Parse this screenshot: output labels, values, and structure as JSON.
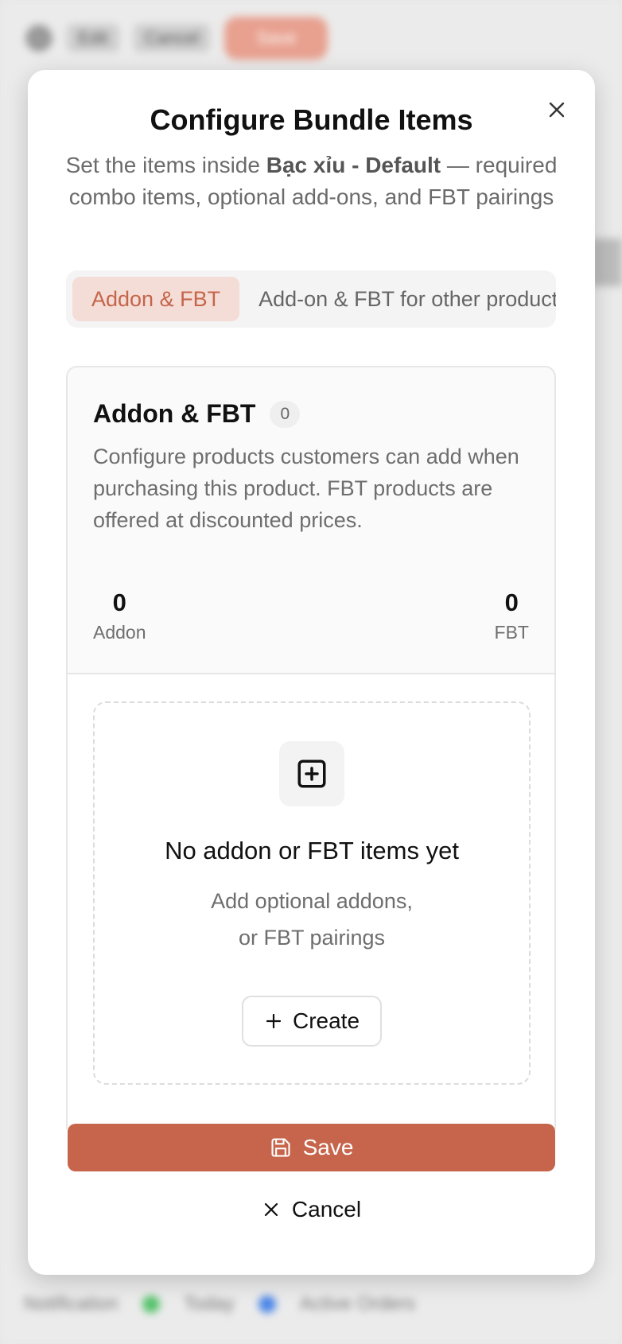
{
  "background": {
    "topbar": {
      "edit": "Edit",
      "cancel": "Cancel",
      "action": "Save"
    },
    "bottombar": {
      "notification": "Notification",
      "today": "Today",
      "active_orders": "Active Orders"
    }
  },
  "modal": {
    "title": "Configure Bundle Items",
    "subtitle_prefix": "Set the items inside ",
    "subtitle_product": "Bạc xỉu - Default",
    "subtitle_suffix": " — required combo items, optional add-ons, and FBT pairings",
    "tabs": [
      {
        "label": "Addon & FBT",
        "active": true
      },
      {
        "label": "Add-on & FBT for other products",
        "active": false
      }
    ],
    "panel": {
      "title": "Addon & FBT",
      "count": "0",
      "description": "Configure products customers can add when purchasing this product. FBT products are offered at discounted prices.",
      "stats": {
        "addon_value": "0",
        "addon_label": "Addon",
        "fbt_value": "0",
        "fbt_label": "FBT"
      },
      "empty": {
        "title": "No addon or FBT items yet",
        "line1": "Add optional addons,",
        "line2": "or FBT pairings",
        "create_label": "Create",
        "icon": "plus-square-icon"
      }
    },
    "save_label": "Save",
    "cancel_label": "Cancel"
  },
  "colors": {
    "accent": "#c6654b",
    "tab_active_bg": "#f4ddd6",
    "tab_active_text": "#c5654a"
  }
}
